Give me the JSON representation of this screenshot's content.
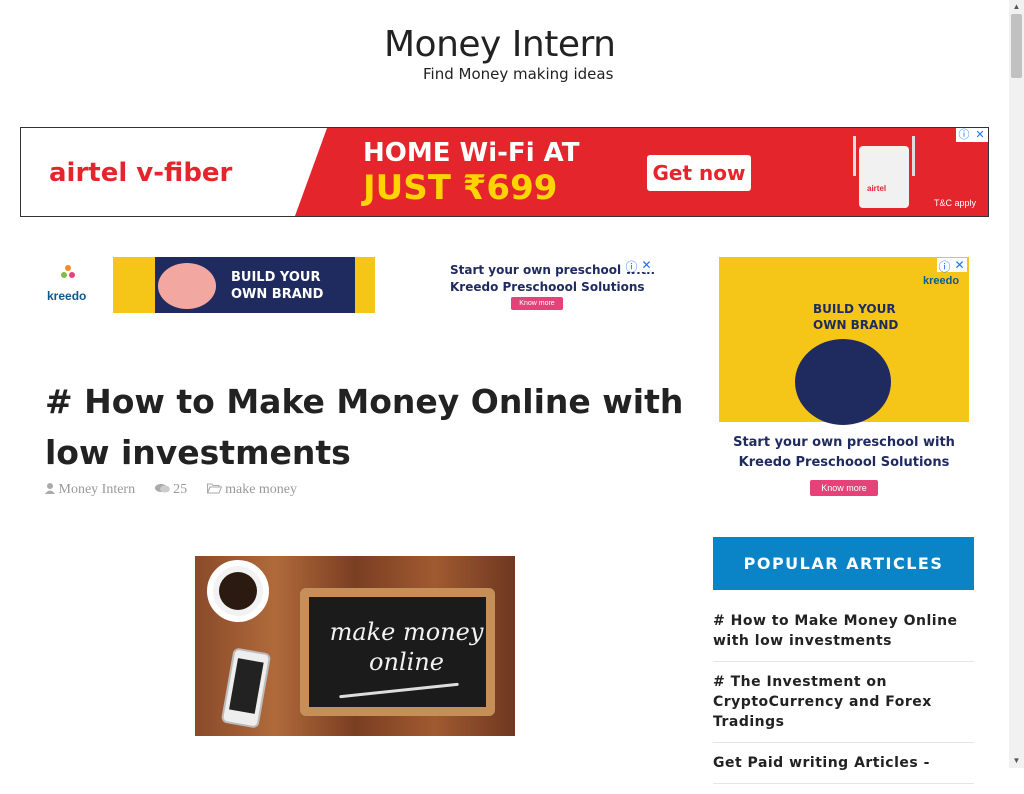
{
  "site": {
    "title": "Money Intern",
    "tagline": "Find Money making ideas"
  },
  "top_ad": {
    "brand": "airtel v-fiber",
    "headline1": "HOME Wi-Fi AT",
    "headline2": "JUST ₹699",
    "cta": "Get now",
    "router_logo": "airtel",
    "terms": "T&C apply",
    "adchoices_icon": "ⓘ",
    "close_icon": "✕"
  },
  "kreedo_banner": {
    "logo": "kreedo",
    "build_line1": "BUILD YOUR",
    "build_line2": "OWN BRAND",
    "start_line1": "Start your own preschool with",
    "start_line2": "Kreedo Preschoool Solutions",
    "cta": "Know more",
    "adchoices_icon": "ⓘ",
    "close_icon": "✕"
  },
  "post": {
    "title": "# How to Make Money Online with low investments",
    "author_icon": "user-icon",
    "author": "Money Intern",
    "comments_icon": "comments-icon",
    "comments": "25",
    "category_icon": "folder-open-icon",
    "category": "make money",
    "image_text_line1": "make money",
    "image_text_line2": "online"
  },
  "sidebar_ad": {
    "logo": "kreedo",
    "build_line1": "BUILD YOUR",
    "build_line2": "OWN BRAND",
    "start_line1": "Start your own preschool with",
    "start_line2": "Kreedo Preschoool Solutions",
    "cta": "Know more",
    "adchoices_icon": "ⓘ",
    "close_icon": "✕"
  },
  "popular": {
    "heading": "POPULAR ARTICLES",
    "items": [
      {
        "label": "# How to Make Money Online with low investments"
      },
      {
        "label": "# The Investment on CryptoCurrency and Forex Tradings"
      },
      {
        "label": "Get Paid writing Articles -"
      }
    ]
  },
  "colors": {
    "accent": "#0a84c6",
    "airtel_red": "#e4262c",
    "kreedo_yellow": "#f5c518",
    "kreedo_navy": "#1f2a5e"
  }
}
